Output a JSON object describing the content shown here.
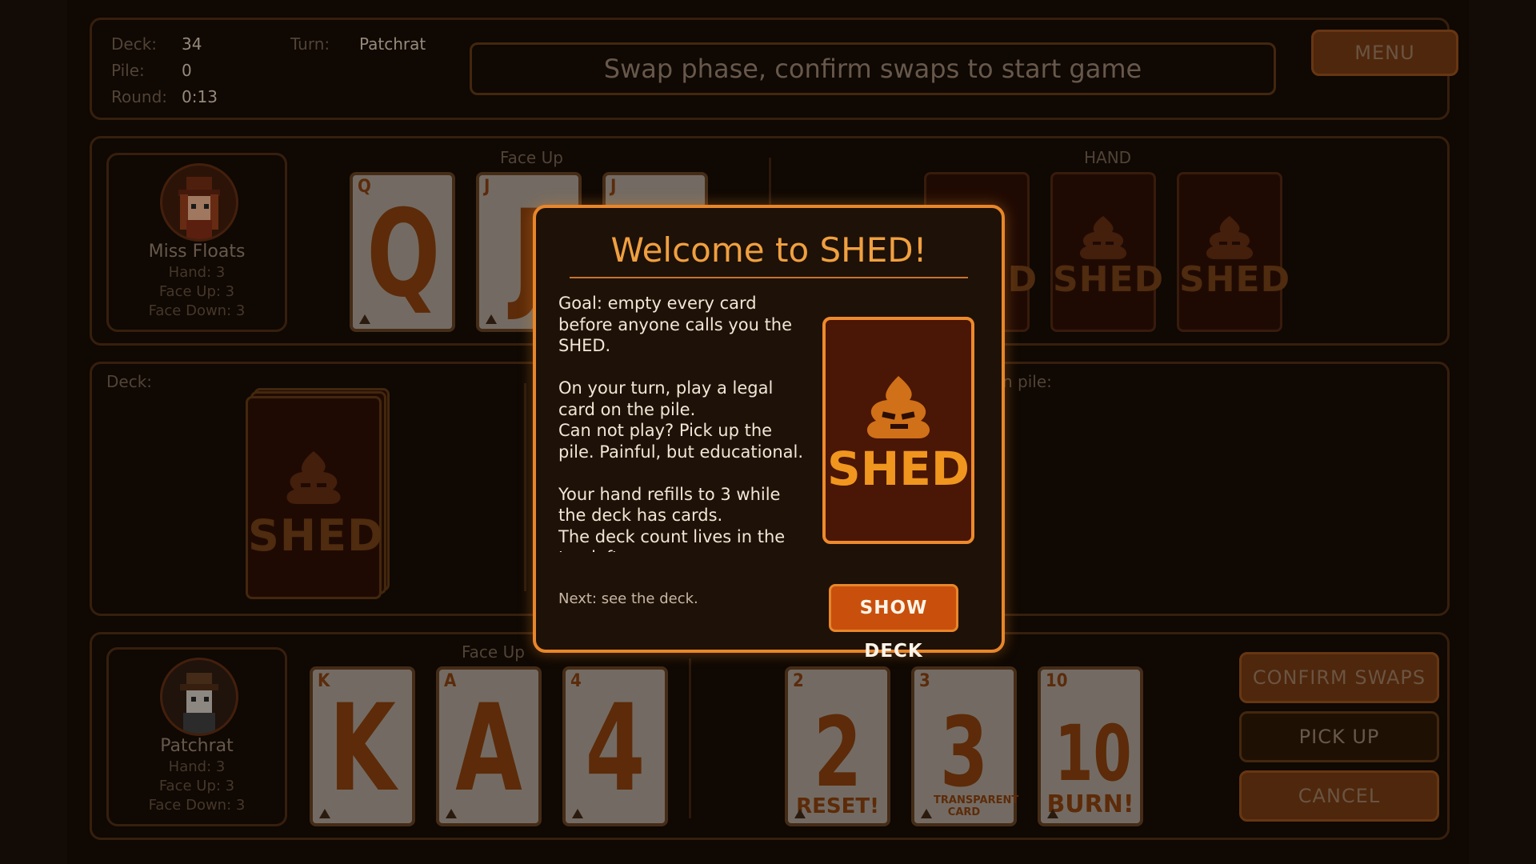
{
  "status": {
    "deck_label": "Deck:",
    "deck_value": "34",
    "pile_label": "Pile:",
    "pile_value": "0",
    "round_label": "Round:",
    "round_value": "0:13",
    "turn_label": "Turn:",
    "turn_value": "Patchrat",
    "message": "Swap phase, confirm swaps to start game",
    "menu_label": "MENU"
  },
  "opponent": {
    "name": "Miss Floats",
    "hand": "Hand: 3",
    "face_up": "Face Up: 3",
    "face_down": "Face Down: 3",
    "face_up_label": "Face Up",
    "hand_label": "HAND",
    "face_up_cards": [
      "Q",
      "J",
      "J"
    ],
    "back_text": "SHED"
  },
  "middle": {
    "deck_label": "Deck:",
    "pile_label": "n pile:",
    "back_text": "SHED"
  },
  "player": {
    "name": "Patchrat",
    "hand": "Hand: 3",
    "face_up": "Face Up: 3",
    "face_down": "Face Down: 3",
    "face_up_label": "Face Up",
    "face_up_cards": [
      "K",
      "A",
      "4"
    ],
    "hand_cards": [
      {
        "rank": "2",
        "sub": "RESET!"
      },
      {
        "rank": "3",
        "sub": "TRANSPARENT CARD"
      },
      {
        "rank": "10",
        "sub": "BURN!"
      }
    ]
  },
  "actions": {
    "confirm_swaps": "CONFIRM SWAPS",
    "pick_up": "PICK UP",
    "cancel": "CANCEL"
  },
  "modal": {
    "title": "Welcome to SHED!",
    "body": "Goal: empty every card before anyone calls you the SHED.\n\nOn your turn, play a legal card on the pile.\nCan not play? Pick up the pile. Painful, but educational.\n\nYour hand refills to 3 while the deck has cards.\nThe deck count lives in the top left.",
    "next": "Next: see the deck.",
    "button": "SHOW DECK",
    "card_text": "SHED"
  },
  "colors": {
    "accent": "#e8862a",
    "panel_border": "#4a2a12",
    "bg": "#150b04"
  }
}
